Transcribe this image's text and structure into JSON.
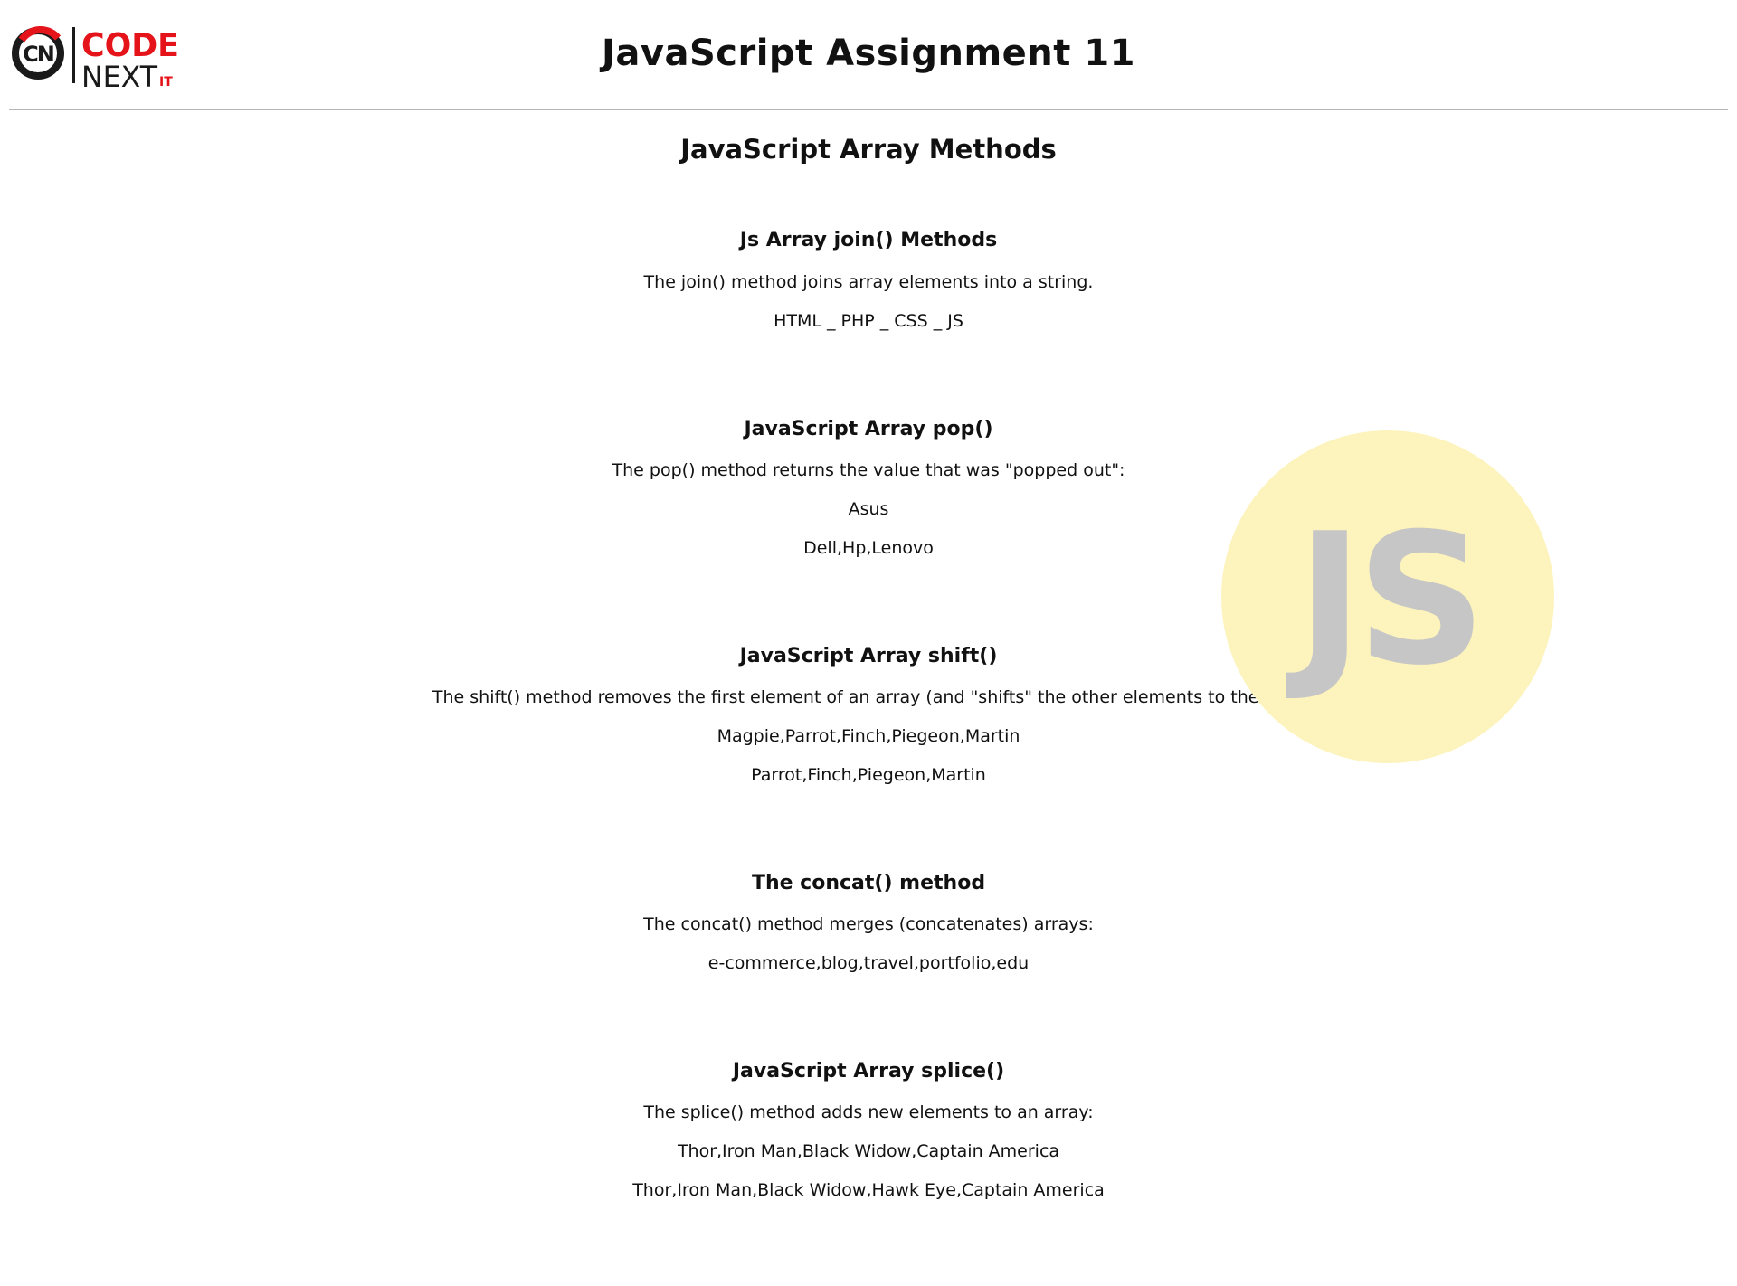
{
  "header": {
    "logo": {
      "monogram": "CN",
      "word_top": "CODE",
      "word_bottom": "NEXT",
      "suffix": "IT",
      "brand_red": "#e5141b",
      "brand_dark": "#1a1a1a"
    },
    "title": "JavaScript Assignment 11"
  },
  "main": {
    "subtitle": "JavaScript Array Methods",
    "badge": {
      "label": "JS",
      "bg_color": "#fdf3bc",
      "text_color": "#c6c6c6"
    },
    "sections": [
      {
        "heading": "Js Array join() Methods",
        "description": "The join() method joins array elements into a string.",
        "outputs": [
          "HTML _ PHP _ CSS _ JS"
        ]
      },
      {
        "heading": "JavaScript Array pop()",
        "description": "The pop() method returns the value that was \"popped out\":",
        "outputs": [
          "Asus",
          "Dell,Hp,Lenovo"
        ]
      },
      {
        "heading": "JavaScript Array shift()",
        "description": "The shift() method removes the first element of an array (and \"shifts\" the other elements to the left):",
        "outputs": [
          "Magpie,Parrot,Finch,Piegeon,Martin",
          "Parrot,Finch,Piegeon,Martin"
        ]
      },
      {
        "heading": "The concat() method",
        "description": "The concat() method merges (concatenates) arrays:",
        "outputs": [
          "e-commerce,blog,travel,portfolio,edu"
        ]
      },
      {
        "heading": "JavaScript Array splice()",
        "description": "The splice() method adds new elements to an array:",
        "outputs": [
          "Thor,Iron Man,Black Widow,Captain America",
          "Thor,Iron Man,Black Widow,Hawk Eye,Captain America"
        ]
      }
    ]
  }
}
